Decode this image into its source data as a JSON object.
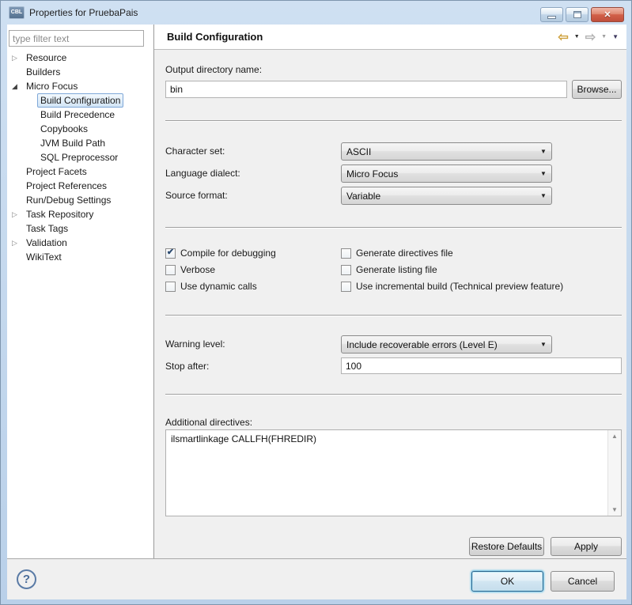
{
  "window": {
    "title": "Properties for PruebaPais",
    "icon_label": "CBL"
  },
  "icons": {
    "tree_collapsed": "▷",
    "tree_expanded": "◢",
    "check": "✔",
    "back_arrow": "⇦",
    "forward_arrow": "⇨",
    "dropdown_arrow": "▼",
    "combo_arrow": "▼",
    "scroll_up": "▲",
    "scroll_down": "▼",
    "close": "✕",
    "help": "?"
  },
  "sidebar": {
    "filter_placeholder": "type filter text",
    "tree": [
      {
        "label": "Resource",
        "level": 0,
        "glyph": "▷",
        "selected": false
      },
      {
        "label": "Builders",
        "level": 0,
        "glyph": "",
        "selected": false
      },
      {
        "label": "Micro Focus",
        "level": 0,
        "glyph": "◢",
        "selected": false
      },
      {
        "label": "Build Configuration",
        "level": 1,
        "glyph": "",
        "selected": true
      },
      {
        "label": "Build Precedence",
        "level": 1,
        "glyph": "",
        "selected": false
      },
      {
        "label": "Copybooks",
        "level": 1,
        "glyph": "",
        "selected": false
      },
      {
        "label": "JVM Build Path",
        "level": 1,
        "glyph": "",
        "selected": false
      },
      {
        "label": "SQL Preprocessor",
        "level": 1,
        "glyph": "",
        "selected": false
      },
      {
        "label": "Project Facets",
        "level": 0,
        "glyph": "",
        "selected": false
      },
      {
        "label": "Project References",
        "level": 0,
        "glyph": "",
        "selected": false
      },
      {
        "label": "Run/Debug Settings",
        "level": 0,
        "glyph": "",
        "selected": false
      },
      {
        "label": "Task Repository",
        "level": 0,
        "glyph": "▷",
        "selected": false
      },
      {
        "label": "Task Tags",
        "level": 0,
        "glyph": "",
        "selected": false
      },
      {
        "label": "Validation",
        "level": 0,
        "glyph": "▷",
        "selected": false
      },
      {
        "label": "WikiText",
        "level": 0,
        "glyph": "",
        "selected": false
      }
    ]
  },
  "header": {
    "title": "Build Configuration"
  },
  "form": {
    "output_dir": {
      "label": "Output directory name:",
      "value": "bin",
      "browse": "Browse..."
    },
    "character_set": {
      "label": "Character set:",
      "value": "ASCII"
    },
    "language_dialect": {
      "label": "Language dialect:",
      "value": "Micro Focus"
    },
    "source_format": {
      "label": "Source format:",
      "value": "Variable"
    },
    "checkboxes": [
      {
        "label": "Compile for debugging",
        "checked": true,
        "glyph": "✔"
      },
      {
        "label": "Verbose",
        "checked": false,
        "glyph": ""
      },
      {
        "label": "Use dynamic calls",
        "checked": false,
        "glyph": ""
      },
      {
        "label": "Generate directives file",
        "checked": false,
        "glyph": ""
      },
      {
        "label": "Generate listing file",
        "checked": false,
        "glyph": ""
      },
      {
        "label": "Use incremental build (Technical preview feature)",
        "checked": false,
        "glyph": ""
      }
    ],
    "warning_level": {
      "label": "Warning level:",
      "value": "Include recoverable errors (Level E)"
    },
    "stop_after": {
      "label": "Stop after:",
      "value": "100"
    },
    "additional_directives": {
      "label": "Additional directives:",
      "value": "ilsmartlinkage CALLFH(FHREDIR)"
    }
  },
  "actions": {
    "restore_defaults": "Restore Defaults",
    "apply": "Apply",
    "ok": "OK",
    "cancel": "Cancel"
  },
  "colors": {
    "titlebar_blue": "#bdd3ea",
    "selection_border": "#7ea7d8",
    "close_button_red": "#c75845",
    "back_arrow_gold": "#cfa23f"
  }
}
